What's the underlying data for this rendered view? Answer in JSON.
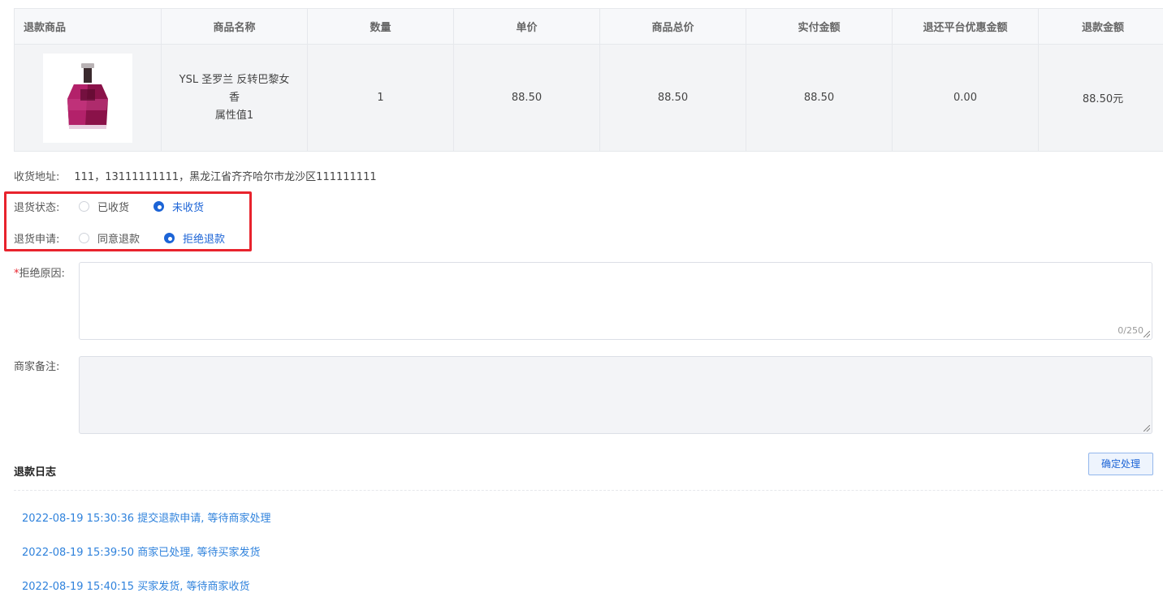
{
  "table": {
    "headers": [
      "退款商品",
      "商品名称",
      "数量",
      "单价",
      "商品总价",
      "实付金额",
      "退还平台优惠金额",
      "退款金额"
    ],
    "row": {
      "product_name_line1": "YSL 圣罗兰 反转巴黎女",
      "product_name_line2": "香",
      "product_attr": "属性值1",
      "quantity": "1",
      "unit_price": "88.50",
      "total_price": "88.50",
      "paid_amount": "88.50",
      "platform_discount_refund": "0.00",
      "refund_amount": "88.50元"
    }
  },
  "address": {
    "label": "收货地址:",
    "value": "111，13111111111，黑龙江省齐齐哈尔市龙沙区111111111"
  },
  "return_status": {
    "label": "退货状态:",
    "options": [
      "已收货",
      "未收货"
    ],
    "selected": "未收货"
  },
  "return_request": {
    "label": "退货申请:",
    "options": [
      "同意退款",
      "拒绝退款"
    ],
    "selected": "拒绝退款"
  },
  "reject_reason": {
    "required_mark": "*",
    "label": "拒绝原因:",
    "value": "",
    "counter": "0/250"
  },
  "merchant_note": {
    "label": "商家备注:",
    "value": ""
  },
  "refund_log": {
    "title": "退款日志",
    "confirm_label": "确定处理",
    "entries": [
      "2022-08-19 15:30:36 提交退款申请, 等待商家处理",
      "2022-08-19 15:39:50 商家已处理, 等待买家发货",
      "2022-08-19 15:40:15 买家发货, 等待商家收货"
    ]
  },
  "colors": {
    "accent": "#1c64d6",
    "highlight": "#e8232d",
    "log_text": "#2f82dc"
  }
}
